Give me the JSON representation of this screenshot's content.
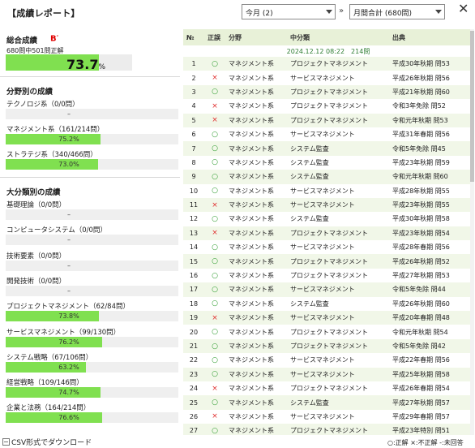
{
  "header": {
    "title": "【成績レポート】",
    "period_select": "今月 (2)",
    "separator": "»",
    "scope_select": "月間合計 (680問)",
    "close_label": "✕"
  },
  "overall": {
    "heading": "総合成績",
    "grade": "B",
    "grade_mark": "-",
    "summary": "680問中501問正解",
    "percent_value": "73.7",
    "percent_unit": "%",
    "ratio": 0.737
  },
  "field_section": {
    "heading": "分野別の成績",
    "items": [
      {
        "label": "テクノロジ系（0/0問）",
        "value": "–",
        "ratio": 0
      },
      {
        "label": "マネジメント系（161/214問）",
        "value": "75.2%",
        "ratio": 0.752
      },
      {
        "label": "ストラテジ系（340/466問）",
        "value": "73.0%",
        "ratio": 0.73
      }
    ]
  },
  "major_section": {
    "heading": "大分類別の成績",
    "items": [
      {
        "label": "基礎理論（0/0問）",
        "value": "–",
        "ratio": 0
      },
      {
        "label": "コンピュータシステム（0/0問）",
        "value": "–",
        "ratio": 0
      },
      {
        "label": "技術要素（0/0問）",
        "value": "–",
        "ratio": 0
      },
      {
        "label": "開発技術（0/0問）",
        "value": "–",
        "ratio": 0
      },
      {
        "label": "プロジェクトマネジメント（62/84問）",
        "value": "73.8%",
        "ratio": 0.738
      },
      {
        "label": "サービスマネジメント（99/130問）",
        "value": "76.2%",
        "ratio": 0.762
      },
      {
        "label": "システム戦略（67/106問）",
        "value": "63.2%",
        "ratio": 0.632
      },
      {
        "label": "経営戦略（109/146問）",
        "value": "74.7%",
        "ratio": 0.747
      },
      {
        "label": "企業と法務（164/214問）",
        "value": "76.6%",
        "ratio": 0.766
      }
    ]
  },
  "csv_label": "CSV形式でダウンロード",
  "table": {
    "headers": [
      "№",
      "正誤",
      "分野",
      "中分類",
      "出典"
    ],
    "date_row": "2024.12.12 08:22　214問",
    "rows": [
      {
        "n": "1",
        "mark": "ok",
        "field": "マネジメント系",
        "sub": "プロジェクトマネジメント",
        "src": "平成30年秋期 問53"
      },
      {
        "n": "2",
        "mark": "ng",
        "field": "マネジメント系",
        "sub": "サービスマネジメント",
        "src": "平成26年秋期 問56"
      },
      {
        "n": "3",
        "mark": "ok",
        "field": "マネジメント系",
        "sub": "プロジェクトマネジメント",
        "src": "平成21年秋期 問60"
      },
      {
        "n": "4",
        "mark": "ng",
        "field": "マネジメント系",
        "sub": "プロジェクトマネジメント",
        "src": "令和3年免除 問52"
      },
      {
        "n": "5",
        "mark": "ng",
        "field": "マネジメント系",
        "sub": "プロジェクトマネジメント",
        "src": "令和元年秋期 問53"
      },
      {
        "n": "6",
        "mark": "ok",
        "field": "マネジメント系",
        "sub": "サービスマネジメント",
        "src": "平成31年春期 問56"
      },
      {
        "n": "7",
        "mark": "ok",
        "field": "マネジメント系",
        "sub": "システム監査",
        "src": "令和5年免除 問45"
      },
      {
        "n": "8",
        "mark": "ok",
        "field": "マネジメント系",
        "sub": "システム監査",
        "src": "平成23年秋期 問59"
      },
      {
        "n": "9",
        "mark": "ok",
        "field": "マネジメント系",
        "sub": "システム監査",
        "src": "令和元年秋期 問60"
      },
      {
        "n": "10",
        "mark": "ok",
        "field": "マネジメント系",
        "sub": "サービスマネジメント",
        "src": "平成28年秋期 問55"
      },
      {
        "n": "11",
        "mark": "ng",
        "field": "マネジメント系",
        "sub": "サービスマネジメント",
        "src": "平成23年秋期 問55"
      },
      {
        "n": "12",
        "mark": "ok",
        "field": "マネジメント系",
        "sub": "システム監査",
        "src": "平成30年秋期 問58"
      },
      {
        "n": "13",
        "mark": "ng",
        "field": "マネジメント系",
        "sub": "プロジェクトマネジメント",
        "src": "平成23年秋期 問54"
      },
      {
        "n": "14",
        "mark": "ok",
        "field": "マネジメント系",
        "sub": "サービスマネジメント",
        "src": "平成28年春期 問56"
      },
      {
        "n": "15",
        "mark": "ok",
        "field": "マネジメント系",
        "sub": "プロジェクトマネジメント",
        "src": "平成26年秋期 問52"
      },
      {
        "n": "16",
        "mark": "ok",
        "field": "マネジメント系",
        "sub": "プロジェクトマネジメント",
        "src": "平成27年秋期 問53"
      },
      {
        "n": "17",
        "mark": "ok",
        "field": "マネジメント系",
        "sub": "サービスマネジメント",
        "src": "令和5年免除 問44"
      },
      {
        "n": "18",
        "mark": "ok",
        "field": "マネジメント系",
        "sub": "システム監査",
        "src": "平成26年秋期 問60"
      },
      {
        "n": "19",
        "mark": "ng",
        "field": "マネジメント系",
        "sub": "サービスマネジメント",
        "src": "平成20年春期 問48"
      },
      {
        "n": "20",
        "mark": "ok",
        "field": "マネジメント系",
        "sub": "プロジェクトマネジメント",
        "src": "令和元年秋期 問54"
      },
      {
        "n": "21",
        "mark": "ok",
        "field": "マネジメント系",
        "sub": "プロジェクトマネジメント",
        "src": "令和5年免除 問42"
      },
      {
        "n": "22",
        "mark": "ok",
        "field": "マネジメント系",
        "sub": "サービスマネジメント",
        "src": "平成22年春期 問56"
      },
      {
        "n": "23",
        "mark": "ok",
        "field": "マネジメント系",
        "sub": "サービスマネジメント",
        "src": "平成25年秋期 問58"
      },
      {
        "n": "24",
        "mark": "ng",
        "field": "マネジメント系",
        "sub": "プロジェクトマネジメント",
        "src": "平成26年春期 問54"
      },
      {
        "n": "25",
        "mark": "ok",
        "field": "マネジメント系",
        "sub": "システム監査",
        "src": "平成27年秋期 問57"
      },
      {
        "n": "26",
        "mark": "ng",
        "field": "マネジメント系",
        "sub": "サービスマネジメント",
        "src": "平成29年春期 問57"
      },
      {
        "n": "27",
        "mark": "ok",
        "field": "マネジメント系",
        "sub": "プロジェクトマネジメント",
        "src": "平成23年特別 問51"
      }
    ]
  },
  "marks": {
    "ok": "○",
    "ng": "×"
  },
  "legend": "○:正解 ×:不正解 -:未回答"
}
